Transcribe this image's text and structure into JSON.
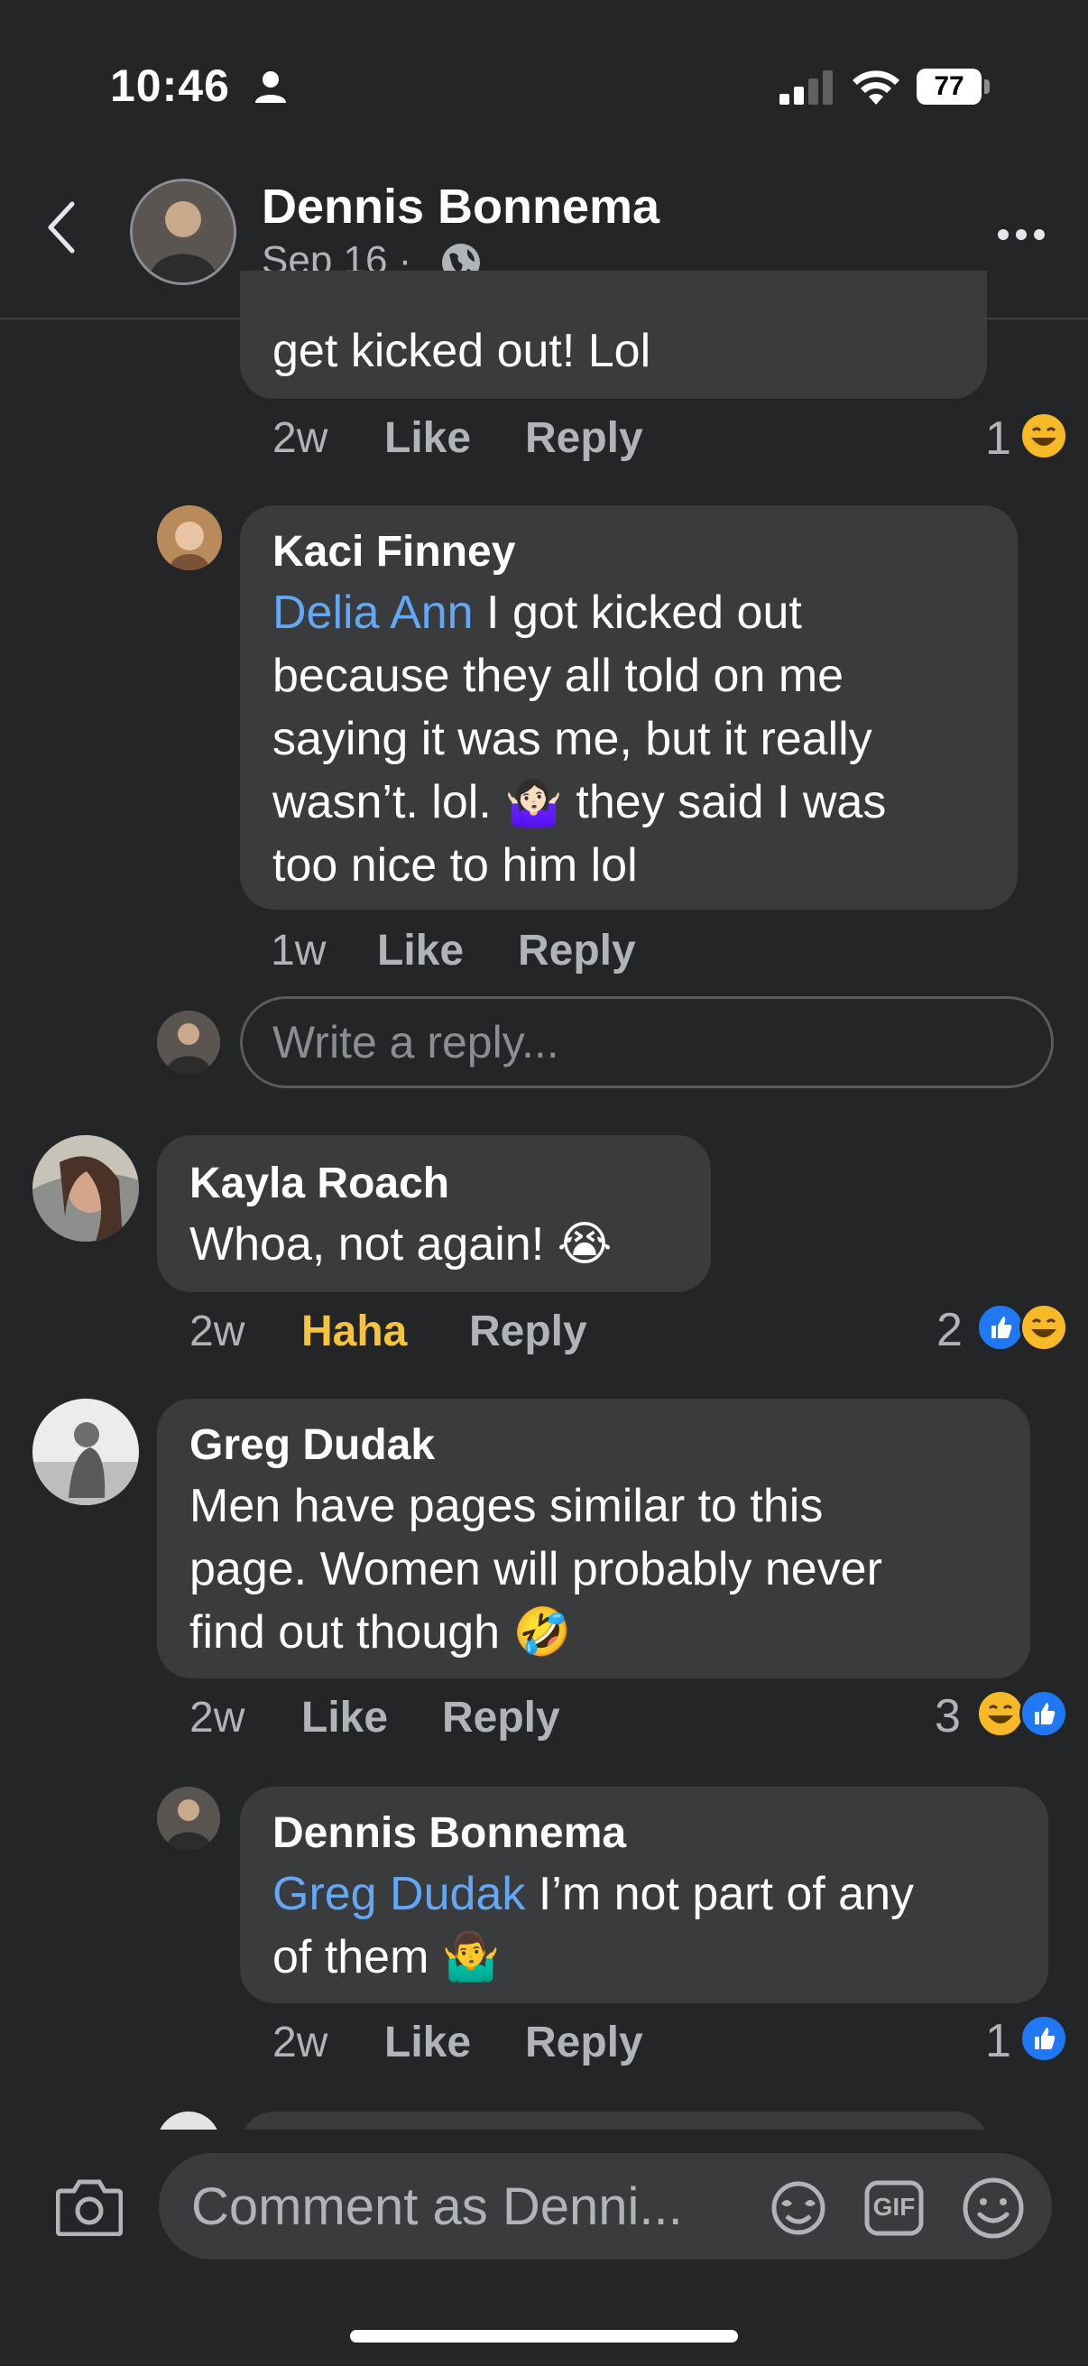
{
  "status_bar": {
    "time": "10:46",
    "battery": "77"
  },
  "header": {
    "name": "Dennis Bonnema",
    "date": "Sep 16 ·"
  },
  "comments": [
    {
      "text": "get kicked out! Lol",
      "time": "2w",
      "like": "Like",
      "reply": "Reply",
      "reaction_count": "1"
    },
    {
      "name": "Kaci Finney",
      "mention": "Delia Ann",
      "text_lines": [
        " I got kicked out",
        "because they all told on me",
        "saying it was me, but it really",
        "wasn’t. lol. 🤷🏻‍♀️ they said I was",
        "too nice to him lol"
      ],
      "time": "1w",
      "like": "Like",
      "reply": "Reply"
    },
    {
      "name": "Kayla Roach",
      "text": "Whoa, not again! 😭",
      "time": "2w",
      "reaction_label": "Haha",
      "reply": "Reply",
      "reaction_count": "2"
    },
    {
      "name": "Greg Dudak",
      "text_lines": [
        "Men have pages similar to this",
        "page. Women will probably never",
        "find out though 🤣"
      ],
      "time": "2w",
      "like": "Like",
      "reply": "Reply",
      "reaction_count": "3"
    },
    {
      "name": "Dennis Bonnema",
      "mention": "Greg Dudak",
      "text_lines": [
        " I’m not part of any",
        "of them 🤷‍♂️"
      ],
      "time": "2w",
      "like": "Like",
      "reply": "Reply",
      "reaction_count": "1"
    }
  ],
  "reply_input": {
    "placeholder": "Write a reply..."
  },
  "bottom_bar": {
    "placeholder": "Comment as Denni...",
    "gif_label": "GIF"
  },
  "colors": {
    "background": "#242526",
    "bubble": "#3a3b3c",
    "mention": "#63a7f5",
    "haha": "#f7c33e",
    "like_blue": "#2078f4"
  },
  "icons": [
    "person-icon",
    "signal-icon",
    "wifi-icon",
    "battery-icon",
    "back-icon",
    "globe-icon",
    "more-icon",
    "camera-icon",
    "avatar-reaction-icon",
    "gif-icon",
    "emoji-icon"
  ]
}
